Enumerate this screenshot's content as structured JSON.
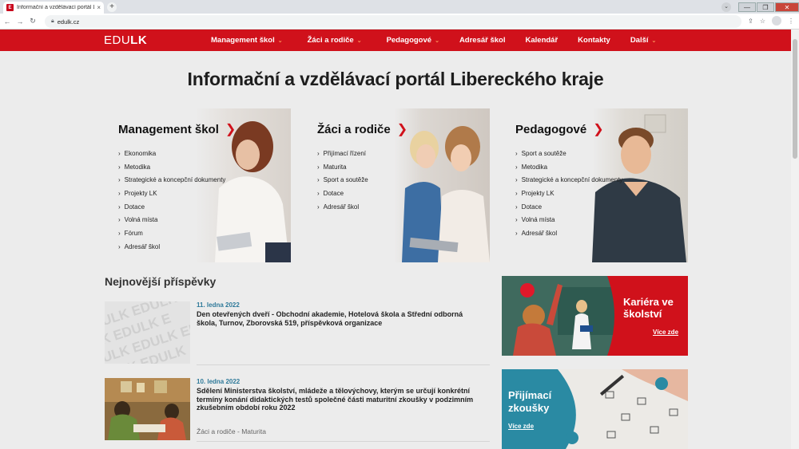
{
  "browser": {
    "tab_title": "Informační a vzdělávací portál Li...",
    "tab_favicon": "E",
    "tab_close": "×",
    "new_tab": "+",
    "url": "edulk.cz",
    "nav_back": "←",
    "nav_forward": "→",
    "nav_reload": "↻",
    "win_minimize": "—",
    "win_maximize": "❐",
    "win_close": "✕"
  },
  "site": {
    "logo_edu": "EDU",
    "logo_lk": "LK",
    "nav": [
      {
        "label": "Management škol",
        "has_dropdown": true
      },
      {
        "label": "Žáci a rodiče",
        "has_dropdown": true
      },
      {
        "label": "Pedagogové",
        "has_dropdown": true
      },
      {
        "label": "Adresář škol",
        "has_dropdown": false
      },
      {
        "label": "Kalendář",
        "has_dropdown": false
      },
      {
        "label": "Kontakty",
        "has_dropdown": false
      },
      {
        "label": "Další",
        "has_dropdown": true
      }
    ],
    "brand_color": "#d0111b",
    "accent_blue": "#2f7a9a"
  },
  "page_title": "Informační a vzdělávací portál Libereckého kraje",
  "cards": [
    {
      "title": "Management škol",
      "items": [
        "Ekonomika",
        "Metodika",
        "Strategické a koncepční dokumenty",
        "Projekty LK",
        "Dotace",
        "Volná místa",
        "Fórum",
        "Adresář škol"
      ]
    },
    {
      "title": "Žáci a rodiče",
      "items": [
        "Přijímací řízení",
        "Maturita",
        "Sport a soutěže",
        "Dotace",
        "Adresář škol"
      ]
    },
    {
      "title": "Pedagogové",
      "items": [
        "Sport a soutěže",
        "Metodika",
        "Strategické a koncepční dokumenty",
        "Projekty LK",
        "Dotace",
        "Volná místa",
        "Adresář škol"
      ]
    }
  ],
  "latest": {
    "heading": "Nejnovější příspěvky",
    "posts": [
      {
        "date": "11. ledna 2022",
        "title": "Den otevřených dveří - Obchodní akademie, Hotelová škola a Střední odborná škola, Turnov, Zborovská 519, příspěvková organizace",
        "categories": "",
        "thumb_text": "EDULK"
      },
      {
        "date": "10. ledna 2022",
        "title": "Sdělení Ministerstva školství, mládeže a tělovýchovy, kterým se určují konkrétní termíny konání didaktických testů společné části maturitní zkoušky v podzimním zkušebním období roku 2022",
        "categories": "Žáci a rodiče - Maturita"
      }
    ]
  },
  "promos": [
    {
      "title_line1": "Kariéra ve",
      "title_line2": "školství",
      "link": "Více zde",
      "color": "#d0111b"
    },
    {
      "title_line1": "Přijímací",
      "title_line2": "zkoušky",
      "link": "Více zde",
      "color": "#2a8aa3"
    }
  ],
  "icons": {
    "chevron": "chevron-down-icon",
    "arrow": "arrow-right-icon",
    "bullet": "›"
  },
  "card_arrow": "❯",
  "nav_chevron": "❯",
  "bullet": "›"
}
